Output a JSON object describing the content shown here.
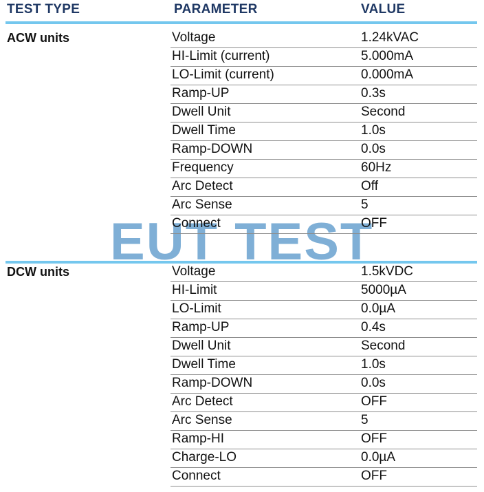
{
  "table": {
    "headers": {
      "test_type": "TEST TYPE",
      "parameter": "PARAMETER",
      "value": "VALUE"
    },
    "accent_color": "#74C7EE",
    "header_color": "#1F3864",
    "sections": [
      {
        "label": "ACW units",
        "rows": [
          {
            "parameter": "Voltage",
            "value": "1.24kVAC"
          },
          {
            "parameter": "HI-Limit (current)",
            "value": "5.000mA"
          },
          {
            "parameter": "LO-Limit (current)",
            "value": "0.000mA"
          },
          {
            "parameter": "Ramp-UP",
            "value": "0.3s"
          },
          {
            "parameter": "Dwell Unit",
            "value": "Second"
          },
          {
            "parameter": "Dwell Time",
            "value": "1.0s"
          },
          {
            "parameter": "Ramp-DOWN",
            "value": "0.0s"
          },
          {
            "parameter": "Frequency",
            "value": "60Hz"
          },
          {
            "parameter": "Arc Detect",
            "value": "Off"
          },
          {
            "parameter": "Arc Sense",
            "value": "5"
          },
          {
            "parameter": "Connect",
            "value": "OFF"
          }
        ]
      },
      {
        "label": "DCW units",
        "rows": [
          {
            "parameter": "Voltage",
            "value": "1.5kVDC"
          },
          {
            "parameter": "HI-Limit",
            "value": "5000µA"
          },
          {
            "parameter": "LO-Limit",
            "value": "0.0µA"
          },
          {
            "parameter": "Ramp-UP",
            "value": "0.4s"
          },
          {
            "parameter": "Dwell Unit",
            "value": "Second"
          },
          {
            "parameter": "Dwell Time",
            "value": "1.0s"
          },
          {
            "parameter": "Ramp-DOWN",
            "value": "0.0s"
          },
          {
            "parameter": "Arc Detect",
            "value": "OFF"
          },
          {
            "parameter": "Arc Sense",
            "value": "5"
          },
          {
            "parameter": "Ramp-HI",
            "value": "OFF"
          },
          {
            "parameter": "Charge-LO",
            "value": "0.0µA"
          },
          {
            "parameter": "Connect",
            "value": "OFF"
          }
        ]
      }
    ]
  },
  "watermark": {
    "text": "EUT TEST",
    "color": "#7FAFD6"
  }
}
